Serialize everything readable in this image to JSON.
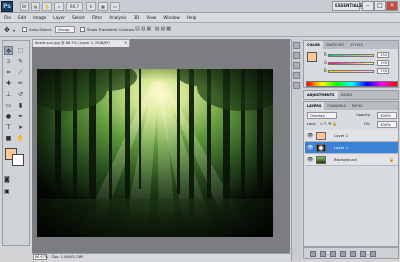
{
  "title_bar": {
    "logo": "Ps",
    "zoom_button": "66.7",
    "workspace_switcher": "ESSENTIALS",
    "minimize": "–",
    "maximize": "□",
    "close": "×"
  },
  "menu": [
    "File",
    "Edit",
    "Image",
    "Layer",
    "Select",
    "Filter",
    "Analysis",
    "3D",
    "View",
    "Window",
    "Help"
  ],
  "options_bar": {
    "auto_select_label": "Auto-Select:",
    "auto_select_value": "Group",
    "show_transform_label": "Show Transform Controls"
  },
  "document": {
    "tab_title": "forest-sun.jpg @ 66.7% (Layer 1, RGB/8*)",
    "tab_close": "×",
    "zoom": "66.67%",
    "info": "Doc: 1.04M/3.74M"
  },
  "color_panel": {
    "tabs": [
      "COLOR",
      "SWATCHES",
      "STYLES"
    ],
    "channels": [
      {
        "label": "R",
        "value": "254"
      },
      {
        "label": "G",
        "value": "199"
      },
      {
        "label": "B",
        "value": "155"
      }
    ],
    "fg_color": "#fdc79a",
    "bg_color": "#ffffff"
  },
  "adjustments_panel": {
    "tabs": [
      "ADJUSTMENTS",
      "MASKS"
    ]
  },
  "layers_panel": {
    "tabs": [
      "LAYERS",
      "CHANNELS",
      "PATHS"
    ],
    "blend_mode": "Overlay",
    "opacity_label": "Opacity:",
    "opacity_value": "100%",
    "lock_label": "Lock:",
    "fill_label": "Fill:",
    "fill_value": "100%",
    "layers": [
      {
        "name": "Layer 2",
        "selected": false,
        "thumb_color": "#fdc79a"
      },
      {
        "name": "Layer 1",
        "selected": true,
        "thumb_color": "#101010"
      },
      {
        "name": "Background",
        "selected": false,
        "thumb_color": "#3e6b2e"
      }
    ]
  },
  "icons": {
    "eye": "eye-icon",
    "move_tool": "move-tool-icon"
  }
}
